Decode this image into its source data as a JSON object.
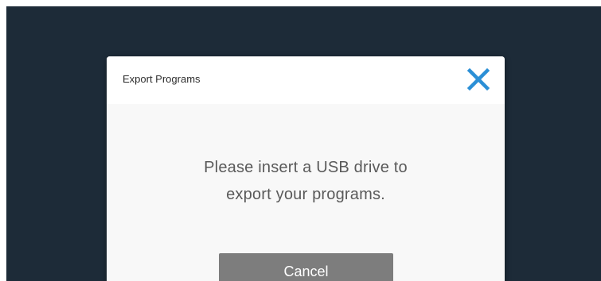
{
  "dialog": {
    "title": "Export Programs",
    "message_line1": "Please insert a USB drive to",
    "message_line2": "export your programs.",
    "cancel_label": "Cancel",
    "close_icon": "close-icon"
  },
  "colors": {
    "background": "#1d2b38",
    "close_icon": "#2b8fd6",
    "cancel_button": "#7d7d7d"
  }
}
